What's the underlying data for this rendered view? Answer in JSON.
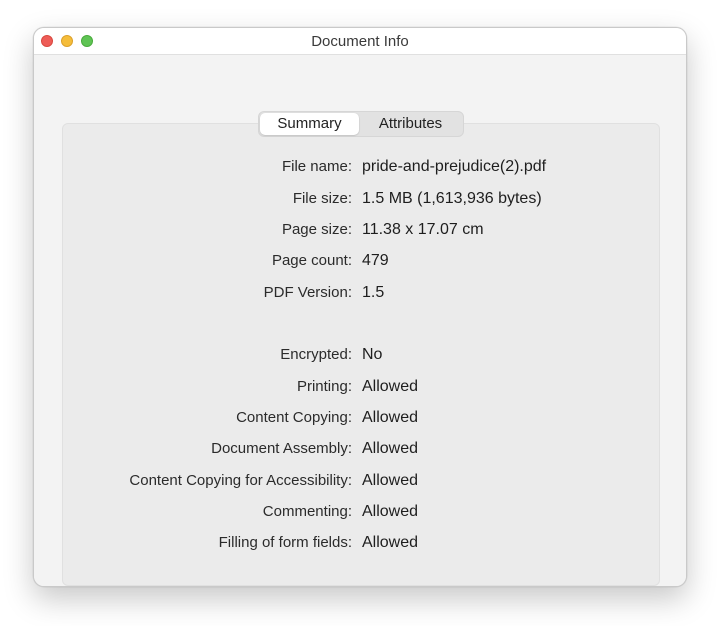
{
  "window": {
    "title": "Document Info"
  },
  "tabs": [
    {
      "label": "Summary",
      "active": true
    },
    {
      "label": "Attributes",
      "active": false
    }
  ],
  "summary": {
    "file_info": [
      {
        "label": "File name:",
        "value": "pride-and-prejudice(2).pdf"
      },
      {
        "label": "File size:",
        "value": "1.5 MB (1,613,936 bytes)"
      },
      {
        "label": "Page size:",
        "value": "11.38 x 17.07 cm"
      },
      {
        "label": "Page count:",
        "value": "479"
      },
      {
        "label": "PDF Version:",
        "value": "1.5"
      }
    ],
    "security": [
      {
        "label": "Encrypted:",
        "value": "No"
      },
      {
        "label": "Printing:",
        "value": "Allowed"
      },
      {
        "label": "Content Copying:",
        "value": "Allowed"
      },
      {
        "label": "Document Assembly:",
        "value": "Allowed"
      },
      {
        "label": "Content Copying for Accessibility:",
        "value": "Allowed"
      },
      {
        "label": "Commenting:",
        "value": "Allowed"
      },
      {
        "label": "Filling of form fields:",
        "value": "Allowed"
      }
    ]
  },
  "colors": {
    "close_button": "#ee5c57",
    "minimize_button": "#f5bd3a",
    "maximize_button": "#5fc454"
  },
  "icons": {
    "close": "close-icon",
    "minimize": "minimize-icon",
    "maximize": "maximize-icon"
  }
}
